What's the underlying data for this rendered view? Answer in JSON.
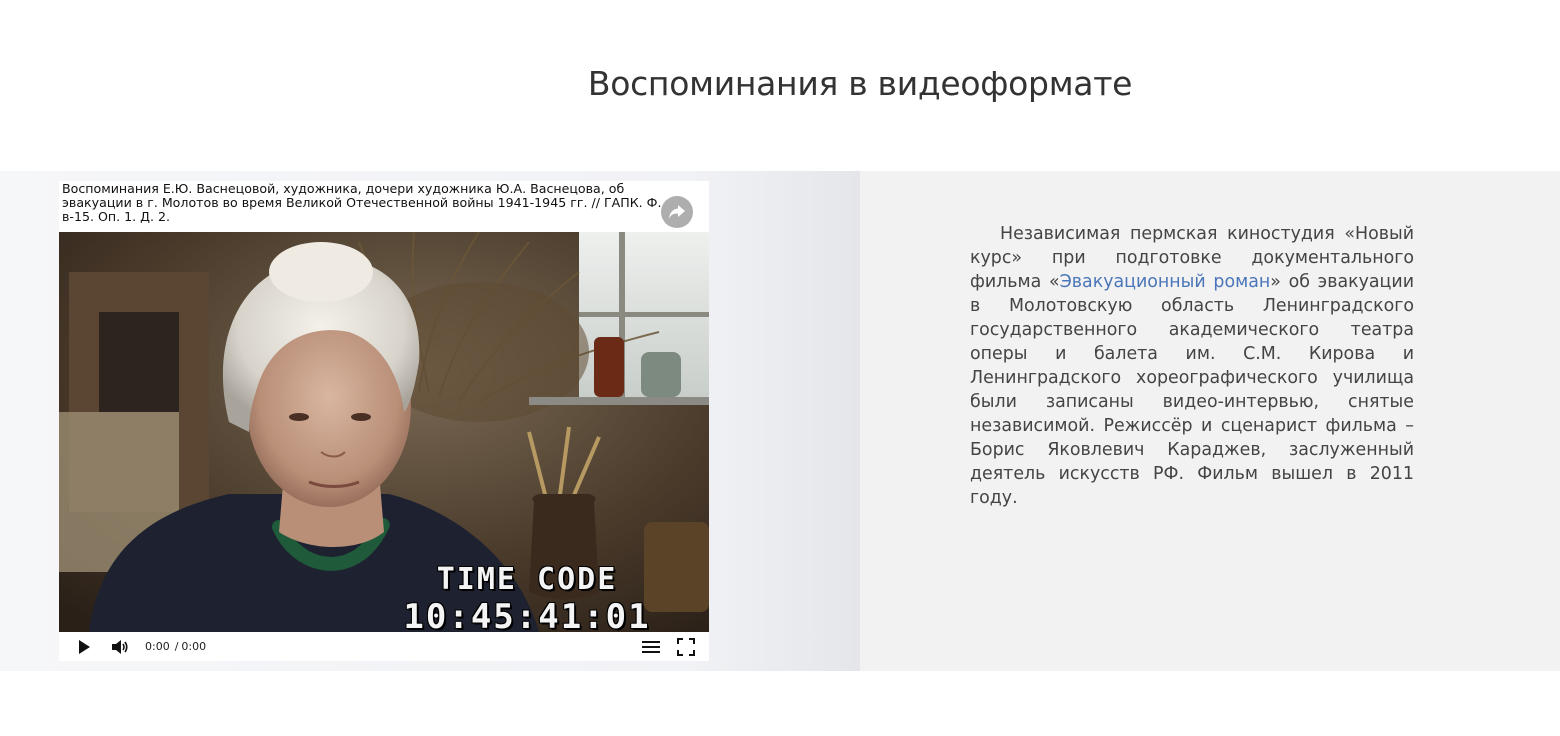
{
  "page": {
    "title": "Воспоминания в видеоформате"
  },
  "player": {
    "caption": "Воспоминания Е.Ю. Васнецовой, художника, дочери художника Ю.А. Васнецова, об эвакуации в г. Молотов во время Великой Отечественной войны 1941-1945 гг. // ГАПК. Ф. в-15. Оп. 1. Д. 2.",
    "overlay": {
      "timecode_label": "TIME CODE",
      "timecode_value": "10:45:41:01"
    },
    "controls": {
      "current_time": "0:00",
      "separator": "/",
      "duration": "0:00",
      "icons": [
        "play-icon",
        "volume-icon",
        "playlist-icon",
        "fullscreen-icon",
        "share-icon"
      ]
    }
  },
  "description": {
    "before_link": "Независимая пермская киностудия «Новый курс» при подготовке документального фильма «",
    "link_text": "Эвакуационный роман",
    "after_link": "» об эвакуации в Молотовскую область Ленинградского государственного академического театра оперы и балета им. С.М. Кирова и Ленинградского хореографического училища были записаны видео-интервью, снятые независимой. Режиссёр и сценарист фильма – Борис Яковлевич Караджев, заслуженный деятель искусств РФ. Фильм вышел в 2011 году."
  },
  "colors": {
    "band_background": "#f3f2f2",
    "link": "#4a76b9",
    "text": "#444444",
    "title": "#333333"
  }
}
